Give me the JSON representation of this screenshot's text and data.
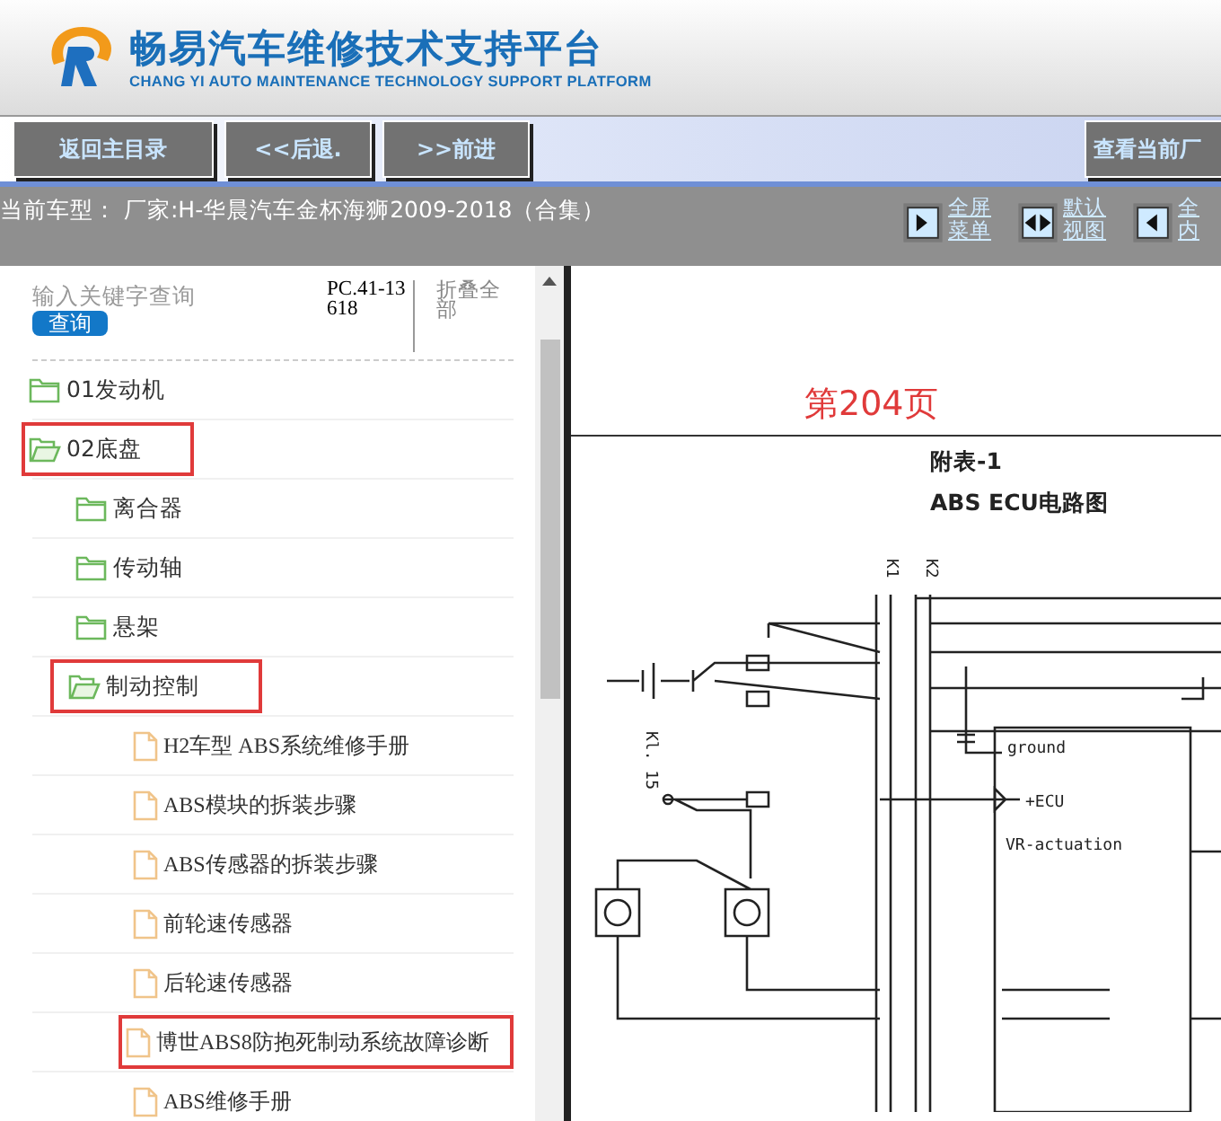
{
  "header": {
    "title": "畅易汽车维修技术支持平台",
    "subtitle": "CHANG YI AUTO MAINTENANCE TECHNOLOGY SUPPORT PLATFORM"
  },
  "nav_buttons": [
    {
      "label": "返回主目录"
    },
    {
      "label": "<<后退."
    },
    {
      "label": ">>前进"
    }
  ],
  "nav_right_button": {
    "label": "查看当前厂"
  },
  "info_bar": {
    "current_model": "当前车型：  厂家:H-华晨汽车金杯海狮2009-2018（合集）",
    "view_buttons": [
      {
        "kind": "menu",
        "line1": "全屏",
        "line2": "菜单"
      },
      {
        "kind": "default",
        "line1": "默认",
        "line2": "视图"
      },
      {
        "kind": "content",
        "line1": "全",
        "line2": "内"
      }
    ]
  },
  "sidebar": {
    "search": {
      "placeholder": "输入关键字查询",
      "button": "查询"
    },
    "code": "PC.41-13618",
    "collapse_all": "折叠全部",
    "tree": [
      {
        "label": "01发动机",
        "kind": "folder",
        "expanded": false,
        "highlighted": false
      },
      {
        "label": "02底盘",
        "kind": "folder",
        "expanded": true,
        "highlighted": true,
        "children": [
          {
            "label": "离合器",
            "kind": "folder",
            "expanded": false,
            "highlighted": false
          },
          {
            "label": "传动轴",
            "kind": "folder",
            "expanded": false,
            "highlighted": false
          },
          {
            "label": "悬架",
            "kind": "folder",
            "expanded": false,
            "highlighted": false
          },
          {
            "label": "制动控制",
            "kind": "folder",
            "expanded": true,
            "highlighted": true,
            "children": [
              {
                "label": "H2车型 ABS系统维修手册",
                "kind": "document",
                "highlighted": false
              },
              {
                "label": "ABS模块的拆装步骤",
                "kind": "document",
                "highlighted": false
              },
              {
                "label": "ABS传感器的拆装步骤",
                "kind": "document",
                "highlighted": false
              },
              {
                "label": "前轮速传感器",
                "kind": "document",
                "highlighted": false
              },
              {
                "label": "后轮速传感器",
                "kind": "document",
                "highlighted": false
              },
              {
                "label": "博世ABS8防抱死制动系统故障诊断",
                "kind": "document",
                "highlighted": true
              },
              {
                "label": "ABS维修手册",
                "kind": "document",
                "highlighted": false
              }
            ]
          }
        ]
      }
    ]
  },
  "document": {
    "page_label": "第204页",
    "table_title": "附表-1",
    "diagram_title": "ABS ECU电路图",
    "diagram_labels": [
      {
        "text": "K1"
      },
      {
        "text": "K2"
      },
      {
        "text": "ground"
      },
      {
        "text": "+ECU"
      },
      {
        "text": "VR-actuation"
      },
      {
        "text": "Kl. 15"
      }
    ]
  }
}
